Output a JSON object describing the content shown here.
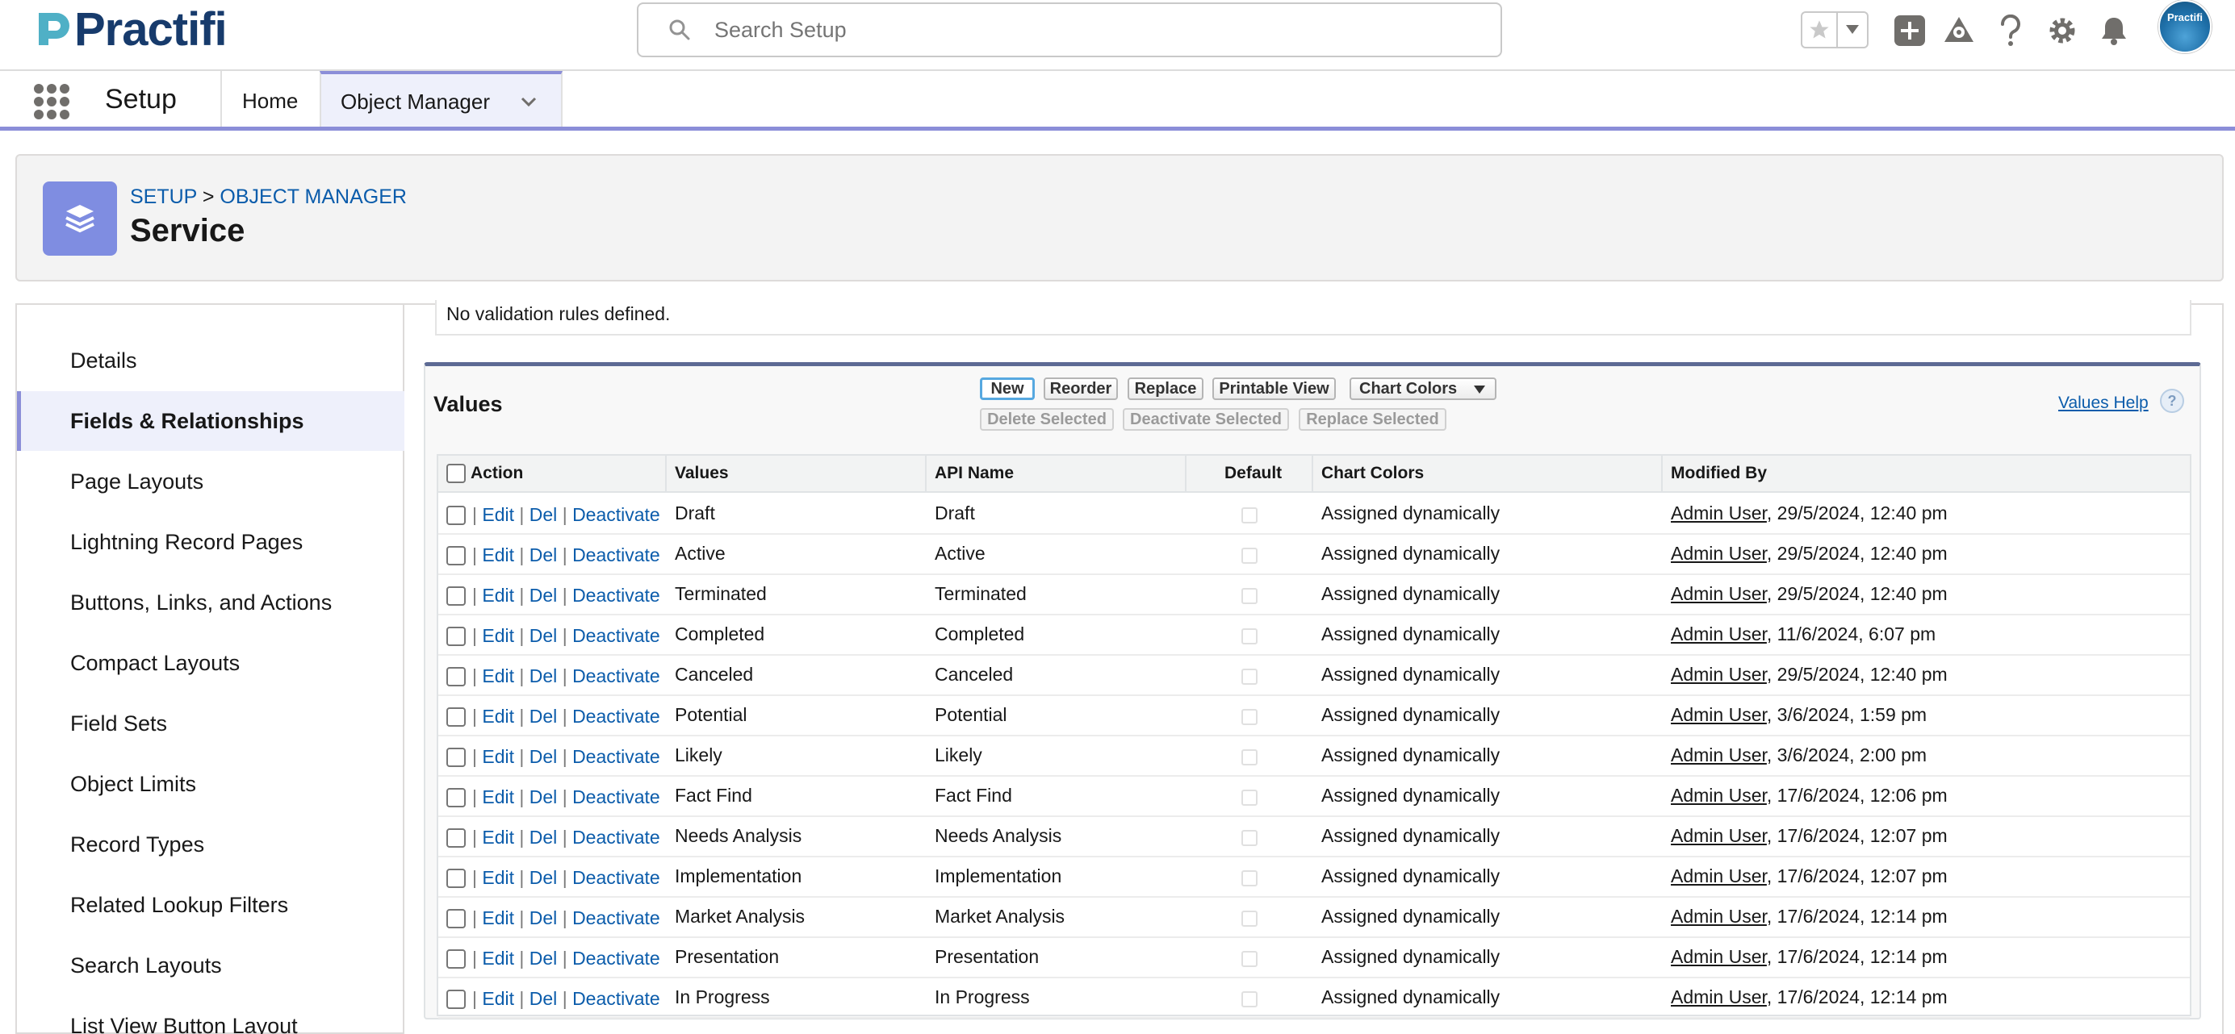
{
  "brand": {
    "name": "Practifi"
  },
  "search": {
    "placeholder": "Search Setup"
  },
  "avatar": {
    "label": "Practifi"
  },
  "nav": {
    "app_name": "Setup",
    "home": "Home",
    "object_manager": "Object Manager"
  },
  "header": {
    "crumb_setup": "SETUP",
    "crumb_sep": ">",
    "crumb_object_manager": "OBJECT MANAGER",
    "title": "Service"
  },
  "sidebar": {
    "items": [
      {
        "label": "Details"
      },
      {
        "label": "Fields & Relationships"
      },
      {
        "label": "Page Layouts"
      },
      {
        "label": "Lightning Record Pages"
      },
      {
        "label": "Buttons, Links, and Actions"
      },
      {
        "label": "Compact Layouts"
      },
      {
        "label": "Field Sets"
      },
      {
        "label": "Object Limits"
      },
      {
        "label": "Record Types"
      },
      {
        "label": "Related Lookup Filters"
      },
      {
        "label": "Search Layouts"
      },
      {
        "label": "List View Button Layout"
      }
    ],
    "active_index": 1
  },
  "validation": {
    "message": "No validation rules defined."
  },
  "values": {
    "title": "Values",
    "buttons": {
      "new": "New",
      "reorder": "Reorder",
      "replace": "Replace",
      "printable": "Printable View",
      "chart_colors": "Chart Colors"
    },
    "bulk": {
      "delete": "Delete Selected",
      "deactivate": "Deactivate Selected",
      "replace": "Replace Selected"
    },
    "help": "Values Help",
    "help_icon": "?",
    "columns": {
      "action": "Action",
      "values": "Values",
      "api": "API Name",
      "default": "Default",
      "chart": "Chart Colors",
      "modified": "Modified By"
    },
    "action_labels": {
      "edit": "Edit",
      "del": "Del",
      "deactivate": "Deactivate",
      "sep": "|"
    },
    "rows": [
      {
        "value": "Draft",
        "api": "Draft",
        "chart": "Assigned dynamically",
        "user": "Admin User",
        "date": ", 29/5/2024, 12:40 pm"
      },
      {
        "value": "Active",
        "api": "Active",
        "chart": "Assigned dynamically",
        "user": "Admin User",
        "date": ", 29/5/2024, 12:40 pm"
      },
      {
        "value": "Terminated",
        "api": "Terminated",
        "chart": "Assigned dynamically",
        "user": "Admin User",
        "date": ", 29/5/2024, 12:40 pm"
      },
      {
        "value": "Completed",
        "api": "Completed",
        "chart": "Assigned dynamically",
        "user": "Admin User",
        "date": ", 11/6/2024, 6:07 pm"
      },
      {
        "value": "Canceled",
        "api": "Canceled",
        "chart": "Assigned dynamically",
        "user": "Admin User",
        "date": ", 29/5/2024, 12:40 pm"
      },
      {
        "value": "Potential",
        "api": "Potential",
        "chart": "Assigned dynamically",
        "user": "Admin User",
        "date": ", 3/6/2024, 1:59 pm"
      },
      {
        "value": "Likely",
        "api": "Likely",
        "chart": "Assigned dynamically",
        "user": "Admin User",
        "date": ", 3/6/2024, 2:00 pm"
      },
      {
        "value": "Fact Find",
        "api": "Fact Find",
        "chart": "Assigned dynamically",
        "user": "Admin User",
        "date": ", 17/6/2024, 12:06 pm"
      },
      {
        "value": "Needs Analysis",
        "api": "Needs Analysis",
        "chart": "Assigned dynamically",
        "user": "Admin User",
        "date": ", 17/6/2024, 12:07 pm"
      },
      {
        "value": "Implementation",
        "api": "Implementation",
        "chart": "Assigned dynamically",
        "user": "Admin User",
        "date": ", 17/6/2024, 12:07 pm"
      },
      {
        "value": "Market Analysis",
        "api": "Market Analysis",
        "chart": "Assigned dynamically",
        "user": "Admin User",
        "date": ", 17/6/2024, 12:14 pm"
      },
      {
        "value": "Presentation",
        "api": "Presentation",
        "chart": "Assigned dynamically",
        "user": "Admin User",
        "date": ", 17/6/2024, 12:14 pm"
      },
      {
        "value": "In Progress",
        "api": "In Progress",
        "chart": "Assigned dynamically",
        "user": "Admin User",
        "date": ", 17/6/2024, 12:14 pm"
      }
    ]
  },
  "colors": {
    "brand": "#173b6c",
    "accent": "#8b8ed8",
    "link": "#0b5cab",
    "object_icon": "#7f8de1"
  },
  "icons": [
    "search-icon",
    "star-icon",
    "chevron-down-icon",
    "add-icon",
    "trailhead-icon",
    "help-icon",
    "gear-icon",
    "bell-icon",
    "app-launcher-icon",
    "layers-icon"
  ]
}
